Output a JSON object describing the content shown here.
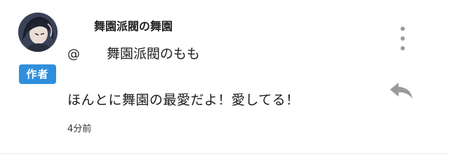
{
  "comment": {
    "username": "舞園派閥の舞園",
    "author_badge": "作者",
    "mention_at": "@",
    "mention_name": "舞園派閥のもも",
    "body": "ほんとに舞園の最愛だよ！愛してる！",
    "timestamp": "4分前"
  },
  "icons": {
    "avatar": "avatar-image",
    "more": "more-vertical-icon",
    "reply": "reply-arrow-icon"
  },
  "colors": {
    "badge_background": "#2f8fdc",
    "icon_gray": "#9a9a9a",
    "divider": "#e4e4e4"
  }
}
